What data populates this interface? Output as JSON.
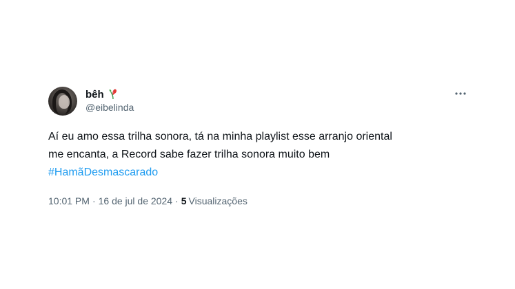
{
  "author": {
    "display_name": "bêh",
    "handle": "@eibelinda"
  },
  "icons": {
    "badge": "red-flower-icon",
    "more": "more-horizontal-icon"
  },
  "tweet": {
    "line1": "Aí eu amo essa trilha sonora, tá na minha playlist esse arranjo oriental",
    "line2": "me encanta, a Record sabe fazer trilha sonora muito bem",
    "hashtag": "#HamãDesmascarado"
  },
  "meta": {
    "time": "10:01 PM",
    "separator": "·",
    "date": "16 de jul de 2024",
    "views_count": "5",
    "views_label": "Visualizações"
  },
  "colors": {
    "link": "#1d9bf0",
    "secondary_text": "#536471",
    "primary_text": "#0f1419"
  }
}
